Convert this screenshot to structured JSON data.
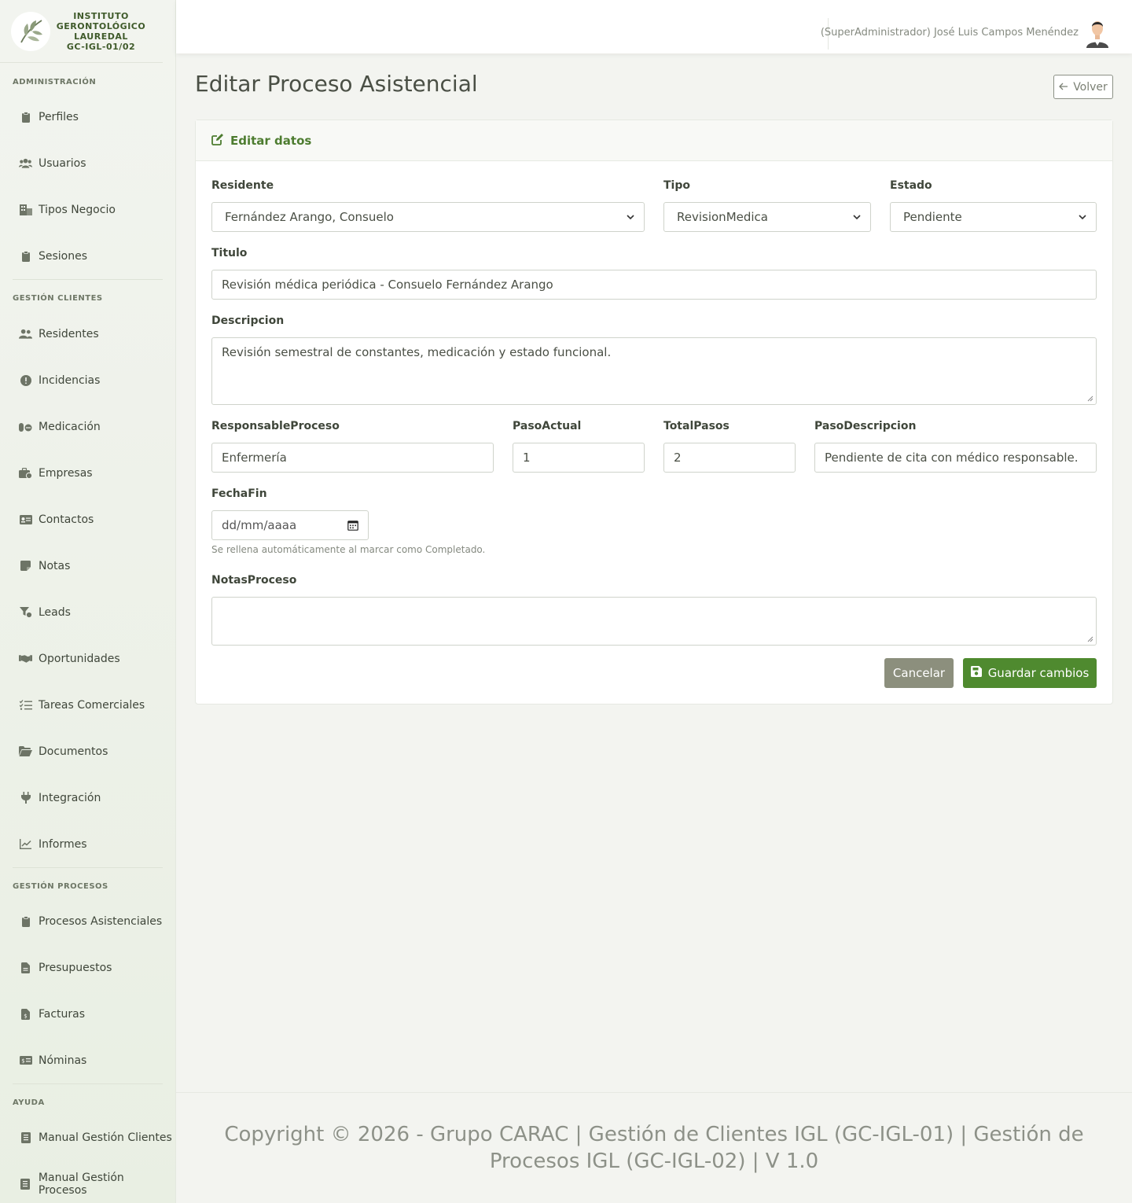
{
  "brand": {
    "line1": "INSTITUTO",
    "line2": "GERONTOLÓGICO",
    "line3": "LAUREDAL",
    "line4": "GC-IGL-01/02"
  },
  "sidebar": {
    "sections": [
      {
        "title": "ADMINISTRACIÓN",
        "items": [
          {
            "label": "Perfiles",
            "icon": "clipboard-icon"
          },
          {
            "label": "Usuarios",
            "icon": "users-icon"
          },
          {
            "label": "Tipos Negocio",
            "icon": "building-icon"
          },
          {
            "label": "Sesiones",
            "icon": "clipboard-icon"
          }
        ]
      },
      {
        "title": "GESTIÓN CLIENTES",
        "items": [
          {
            "label": "Residentes",
            "icon": "user-group-icon"
          },
          {
            "label": "Incidencias",
            "icon": "alert-icon"
          },
          {
            "label": "Medicación",
            "icon": "pills-icon"
          },
          {
            "label": "Empresas",
            "icon": "briefcase-icon"
          },
          {
            "label": "Contactos",
            "icon": "id-card-icon"
          },
          {
            "label": "Notas",
            "icon": "note-icon"
          },
          {
            "label": "Leads",
            "icon": "filter-icon"
          },
          {
            "label": "Oportunidades",
            "icon": "handshake-icon"
          },
          {
            "label": "Tareas Comerciales",
            "icon": "list-check-icon"
          },
          {
            "label": "Documentos",
            "icon": "folder-icon"
          },
          {
            "label": "Integración",
            "icon": "plug-icon"
          },
          {
            "label": "Informes",
            "icon": "chart-line-icon"
          }
        ]
      },
      {
        "title": "GESTIÓN PROCESOS",
        "items": [
          {
            "label": "Procesos Asistenciales",
            "icon": "clipboard-icon"
          },
          {
            "label": "Presupuestos",
            "icon": "file-icon"
          },
          {
            "label": "Facturas",
            "icon": "invoice-icon"
          },
          {
            "label": "Nóminas",
            "icon": "money-icon"
          }
        ]
      },
      {
        "title": "AYUDA",
        "items": [
          {
            "label": "Manual Gestión Clientes",
            "icon": "book-icon"
          },
          {
            "label": "Manual Gestión Procesos",
            "icon": "book-icon"
          }
        ]
      }
    ]
  },
  "topbar": {
    "user": "(SuperAdministrador) José Luis Campos Menéndez"
  },
  "page": {
    "title": "Editar Proceso Asistencial",
    "back_label": "Volver"
  },
  "card": {
    "header": "Editar datos"
  },
  "form": {
    "residente": {
      "label": "Residente",
      "value": "Fernández Arango, Consuelo"
    },
    "tipo": {
      "label": "Tipo",
      "value": "RevisionMedica"
    },
    "estado": {
      "label": "Estado",
      "value": "Pendiente"
    },
    "titulo": {
      "label": "Titulo",
      "value": "Revisión médica periódica - Consuelo Fernández Arango"
    },
    "descripcion": {
      "label": "Descripcion",
      "value": "Revisión semestral de constantes, medicación y estado funcional."
    },
    "responsable": {
      "label": "ResponsableProceso",
      "value": "Enfermería"
    },
    "paso_actual": {
      "label": "PasoActual",
      "value": "1"
    },
    "total_pasos": {
      "label": "TotalPasos",
      "value": "2"
    },
    "paso_descripcion": {
      "label": "PasoDescripcion",
      "value": "Pendiente de cita con médico responsable."
    },
    "fecha_fin": {
      "label": "FechaFin",
      "placeholder": "dd/mm/aaaa",
      "hint": "Se rellena automáticamente al marcar como Completado."
    },
    "notas": {
      "label": "NotasProceso",
      "value": ""
    },
    "cancel_label": "Cancelar",
    "save_label": "Guardar cambios"
  },
  "footer": {
    "text": "Copyright © 2026 - Grupo CARAC | Gestión de Clientes IGL (GC-IGL-01) | Gestión de Procesos IGL (GC-IGL-02) | V 1.0"
  },
  "colors": {
    "accent": "#4f8a2f",
    "brand_text": "#3f5a2a",
    "cancel": "#8c8f7d"
  }
}
